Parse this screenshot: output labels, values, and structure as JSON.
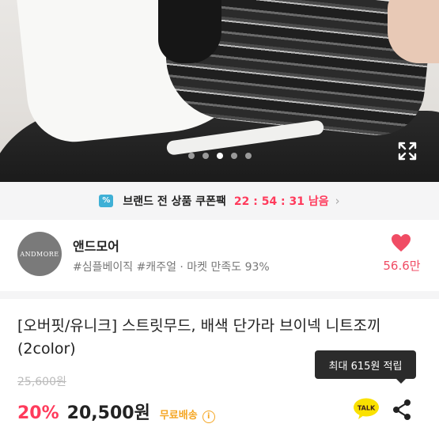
{
  "gallery": {
    "dot_count": 5,
    "active_index": 2,
    "expand_icon": "expand-icon"
  },
  "coupon": {
    "icon": "coupon-icon",
    "label": "브랜드 전 상품 쿠폰팩",
    "timer": "22 : 54 : 31 남음",
    "chevron": "›",
    "accent": "#ff3b5c"
  },
  "seller": {
    "avatar_text": "ANDMORE",
    "name": "앤드모어",
    "meta": "#심플베이직 #캐주얼 · 마켓 만족도 93%",
    "likes": "56.6만",
    "heart_color": "#f04c64"
  },
  "product": {
    "title": "[오버핏/유니크] 스트릿무드, 배색 단가라 브이넥 니트조끼 (2color)",
    "original_price": "25,600원",
    "discount": "20%",
    "price": "20,500원",
    "shipping": "무료배송",
    "info_icon": "i",
    "points_tooltip": "최대 615원 적립",
    "talk_label": "TALK",
    "talk_color": "#3c1e1e",
    "kakao_color": "#fae100"
  }
}
